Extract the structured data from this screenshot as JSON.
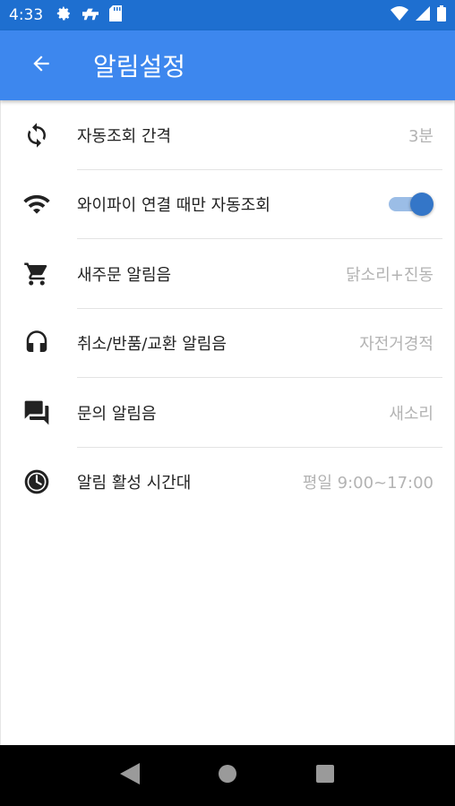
{
  "status_bar": {
    "time": "4:33",
    "left_icons": [
      "settings-icon",
      "android-icon",
      "sd-card-icon"
    ],
    "right_icons": [
      "wifi-icon",
      "signal-icon",
      "battery-icon"
    ]
  },
  "app_bar": {
    "title": "알림설정",
    "back_icon": "arrow-back-icon",
    "color": "#3d87ee"
  },
  "settings": [
    {
      "icon": "sync-icon",
      "label": "자동조회 간격",
      "value": "3분"
    },
    {
      "icon": "wifi-icon",
      "label": "와이파이 연결 때만 자동조회",
      "toggle": true
    },
    {
      "icon": "cart-icon",
      "label": "새주문 알림음",
      "value": "닭소리+진동"
    },
    {
      "icon": "headphones-icon",
      "label": "취소/반품/교환 알림음",
      "value": "자전거경적"
    },
    {
      "icon": "chat-icon",
      "label": "문의 알림음",
      "value": "새소리"
    },
    {
      "icon": "clock-icon",
      "label": "알림 활성 시간대",
      "value": "평일 9:00~17:00"
    }
  ],
  "nav_bar": {
    "buttons": [
      "back-triangle-icon",
      "home-circle-icon",
      "recents-square-icon"
    ]
  }
}
